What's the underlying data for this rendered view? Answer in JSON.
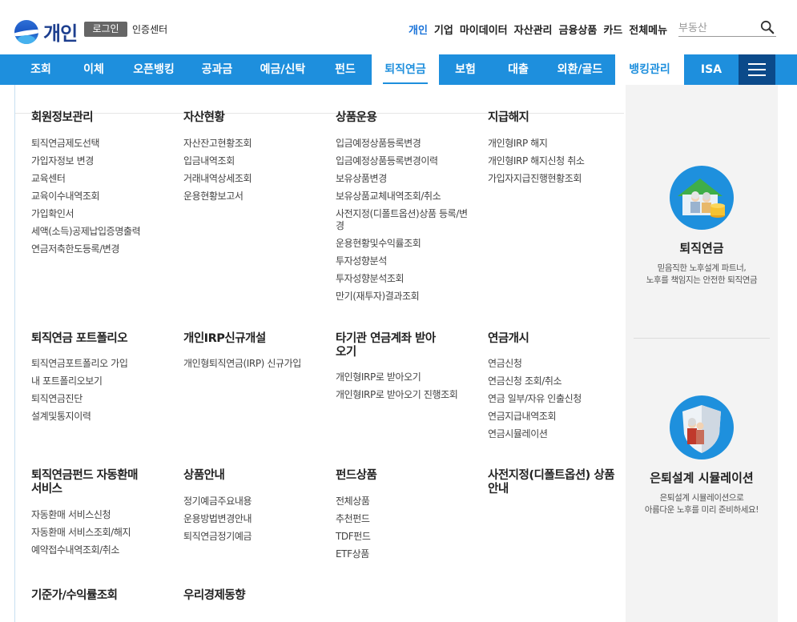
{
  "header": {
    "logo_text": "개인",
    "login_label": "로그인",
    "cert_label": "인증센터",
    "topnav": [
      "개인",
      "기업",
      "마이데이터",
      "자산관리",
      "금융상품",
      "카드",
      "전체메뉴"
    ],
    "search_placeholder": "부동산"
  },
  "gnb": {
    "items": [
      "조회",
      "이체",
      "오픈뱅킹",
      "공과금",
      "예금/신탁",
      "펀드",
      "퇴직연금",
      "보험",
      "대출",
      "외환/골드",
      "뱅킹관리",
      "ISA"
    ],
    "active": "퇴직연금"
  },
  "menu": {
    "row1": [
      {
        "title": "회원정보관리",
        "items": [
          "퇴직연금제도선택",
          "가입자정보 변경",
          "교육센터",
          "교육이수내역조회",
          "가입확인서",
          "세액(소득)공제납입증명출력",
          "연금저축한도등록/변경"
        ]
      },
      {
        "title": "자산현황",
        "items": [
          "자산잔고현황조회",
          "입금내역조회",
          "거래내역상세조회",
          "운용현황보고서"
        ]
      },
      {
        "title": "상품운용",
        "items": [
          "입금예정상품등록변경",
          "입금예정상품등록변경이력",
          "보유상품변경",
          "보유상품교체내역조회/취소",
          "사전지정(디폴트옵션)상품 등록/변경",
          "운용현황및수익률조회",
          "투자성향분석",
          "투자성향분석조회",
          "만기(재투자)결과조회"
        ]
      },
      {
        "title": "지급해지",
        "items": [
          "개인형IRP 해지",
          "개인형IRP 해지신청 취소",
          "가입자지급진행현황조회"
        ]
      }
    ],
    "row2": [
      {
        "title": "퇴직연금 포트폴리오",
        "items": [
          "퇴직연금포트폴리오 가입",
          "내 포트폴리오보기",
          "퇴직연금진단",
          "설계및통지이력"
        ]
      },
      {
        "title": "개인IRP신규개설",
        "items": [
          "개인형퇴직연금(IRP) 신규가입"
        ]
      },
      {
        "title": "타기관 연금계좌 받아오기",
        "items": [
          "개인형IRP로 받아오기",
          "개인형IRP로 받아오기 진행조회"
        ]
      },
      {
        "title": "연금개시",
        "items": [
          "연금신청",
          "연금신청 조회/취소",
          "연금 일부/자유 인출신청",
          "연금지급내역조회",
          "연금시뮬레이션"
        ]
      }
    ],
    "row3": [
      {
        "title": "퇴직연금펀드 자동환매서비스",
        "items": [
          "자동환매 서비스신청",
          "자동환매 서비스조회/해지",
          "예약접수내역조회/취소"
        ]
      },
      {
        "title": "상품안내",
        "items": [
          "정기예금주요내용",
          "운용방법변경안내",
          "퇴직연금정기예금"
        ]
      },
      {
        "title": "펀드상품",
        "items": [
          "전체상품",
          "추천펀드",
          "TDF펀드",
          "ETF상품"
        ]
      },
      {
        "title": "사전지정(디폴트옵션) 상품안내",
        "items": []
      }
    ],
    "row4": [
      {
        "title": "기준가/수익률조회",
        "items": []
      },
      {
        "title": "우리경제동향",
        "items": []
      }
    ]
  },
  "aside": {
    "promo1": {
      "title": "퇴직연금",
      "desc1": "믿음직한 노후설계 파트너,",
      "desc2": "노후를 책임지는 안전한 퇴직연금",
      "icon": "retirement-house-icon"
    },
    "promo2": {
      "title": "은퇴설계 시뮬레이션",
      "desc1": "은퇴설계 시뮬레이션으로",
      "desc2": "아름다운 노후를 미리 준비하세요!",
      "icon": "retirement-shield-icon"
    }
  },
  "colors": {
    "brand": "#1e8fdd",
    "dark": "#0b4a8a",
    "active_topnav": "#1a73d9"
  }
}
